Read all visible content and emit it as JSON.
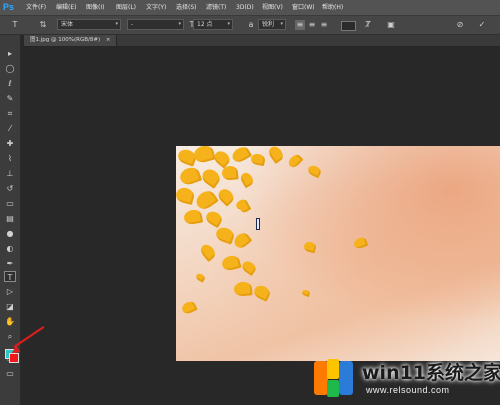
{
  "app": {
    "logo": "Ps"
  },
  "menu": [
    "文件(F)",
    "编辑(E)",
    "图像(I)",
    "图层(L)",
    "文字(Y)",
    "选择(S)",
    "滤镜(T)",
    "3D(D)",
    "视图(V)",
    "窗口(W)",
    "帮助(H)"
  ],
  "options_bar": {
    "font_family": "宋体",
    "font_style": "-",
    "font_size": "12 点",
    "antialias": "锐利",
    "icons": [
      "text-tool-icon",
      "text-orientation-icon",
      "align-left-icon",
      "align-center-icon",
      "align-right-icon",
      "text-color-swatch",
      "warp-text-icon",
      "character-panel-icon",
      "cancel-icon",
      "commit-icon"
    ]
  },
  "document": {
    "tab_label": "图1.jpg @ 100%(RGB/8#)",
    "close_symbol": "×"
  },
  "tools": [
    "move-tool-icon",
    "marquee-tool-icon",
    "lasso-tool-icon",
    "quick-select-tool-icon",
    "crop-tool-icon",
    "eyedropper-tool-icon",
    "healing-tool-icon",
    "brush-tool-icon",
    "clone-stamp-tool-icon",
    "history-brush-tool-icon",
    "eraser-tool-icon",
    "gradient-tool-icon",
    "blur-tool-icon",
    "dodge-tool-icon",
    "pen-tool-icon",
    "type-tool-icon",
    "path-select-tool-icon",
    "shape-tool-icon",
    "hand-tool-icon",
    "zoom-tool-icon"
  ],
  "colors": {
    "foreground": "#2fc6c6",
    "background": "#f01818",
    "annotation_arrow": "#e01d1d"
  },
  "watermark": {
    "title": "win11系统之家",
    "url": "www.relsound.com"
  }
}
